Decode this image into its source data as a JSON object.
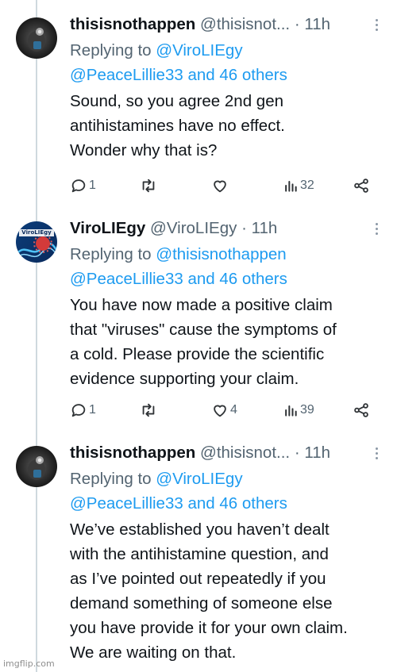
{
  "tweets": [
    {
      "name": "thisisnothappen",
      "handle": "@thisisnot...",
      "sep": "·",
      "time": "11h",
      "replying_prefix": "Replying to",
      "replying_user": "@ViroLIEgy",
      "replying_line2": "@PeaceLillie33 and 46 others",
      "body_lines": [
        "Sound, so you agree 2nd gen",
        "antihistamines have no effect.",
        "Wonder why that is?"
      ],
      "replies": "1",
      "retweets": "",
      "likes": "",
      "views": "32"
    },
    {
      "name": "ViroLIEgy",
      "handle": "@ViroLIEgy",
      "sep": "·",
      "time": "11h",
      "replying_prefix": "Replying to",
      "replying_user": "@thisisnothappen",
      "replying_line2": "@PeaceLillie33 and 46 others",
      "body_lines": [
        "You have now made a positive claim",
        "that \"viruses\" cause the symptoms of",
        "a cold. Please provide the scientific",
        "evidence supporting your claim."
      ],
      "replies": "1",
      "retweets": "",
      "likes": "4",
      "views": "39"
    },
    {
      "name": "thisisnothappen",
      "handle": "@thisisnot...",
      "sep": "·",
      "time": "11h",
      "replying_prefix": "Replying to",
      "replying_user": "@ViroLIEgy",
      "replying_line2": "@PeaceLillie33 and 46 others",
      "body_lines": [
        "We’ve established you haven’t dealt",
        "with the antihistamine question, and",
        "as I’ve pointed out repeatedly if you",
        "demand something of someone else",
        "you have provide it for your own claim.",
        "We are waiting on that."
      ]
    }
  ],
  "avatar_logo_text": "ViroLIEgy",
  "watermark": "imgflip.com",
  "colors": {
    "link": "#1d9bf0",
    "muted": "#536471",
    "thread_line": "#cfd9de",
    "text": "#0f1419"
  }
}
